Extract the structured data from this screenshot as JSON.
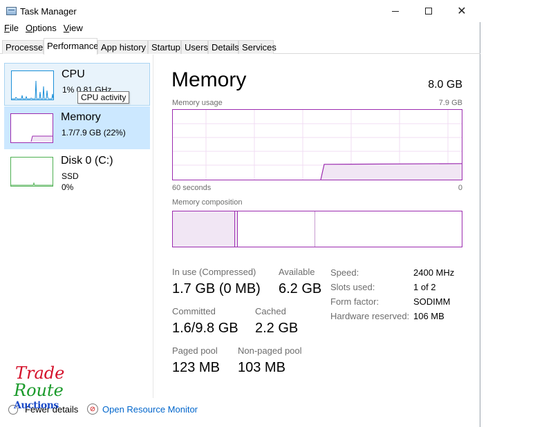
{
  "window": {
    "title": "Task Manager"
  },
  "menu": {
    "file": "File",
    "options": "Options",
    "view": "View"
  },
  "tabs": [
    "Processes",
    "Performance",
    "App history",
    "Startup",
    "Users",
    "Details",
    "Services"
  ],
  "active_tab": "Performance",
  "sidebar": {
    "cpu": {
      "name": "CPU",
      "detail": "1%  0.81 GHz",
      "tooltip": "CPU activity"
    },
    "memory": {
      "name": "Memory",
      "detail": "1.7/7.9 GB (22%)"
    },
    "disk": {
      "name": "Disk 0 (C:)",
      "type": "SSD",
      "usage": "0%"
    }
  },
  "main": {
    "title": "Memory",
    "total": "8.0 GB",
    "graph": {
      "label": "Memory usage",
      "max": "7.9 GB",
      "left_axis": "60 seconds",
      "right_axis": "0",
      "current_used_fraction": 0.22
    },
    "composition": {
      "label": "Memory composition"
    },
    "stats": {
      "in_use_label": "In use (Compressed)",
      "in_use_value": "1.7 GB (0 MB)",
      "available_label": "Available",
      "available_value": "6.2 GB",
      "committed_label": "Committed",
      "committed_value": "1.6/9.8 GB",
      "cached_label": "Cached",
      "cached_value": "2.2 GB",
      "paged_label": "Paged pool",
      "paged_value": "123 MB",
      "nonpaged_label": "Non-paged pool",
      "nonpaged_value": "103 MB"
    },
    "specs": [
      {
        "label": "Speed:",
        "value": "2400 MHz"
      },
      {
        "label": "Slots used:",
        "value": "1 of 2"
      },
      {
        "label": "Form factor:",
        "value": "SODIMM"
      },
      {
        "label": "Hardware reserved:",
        "value": "106 MB"
      }
    ]
  },
  "footer": {
    "fewer_details": "Fewer details",
    "open_resource_monitor": "Open Resource Monitor"
  },
  "watermark": {
    "line1": "Trade",
    "line2": "Route",
    "line3": "Auctions"
  },
  "colors": {
    "memory": "#9b2aaf",
    "cpu": "#1b8fd8",
    "disk": "#4caf50",
    "link": "#0066cc"
  }
}
